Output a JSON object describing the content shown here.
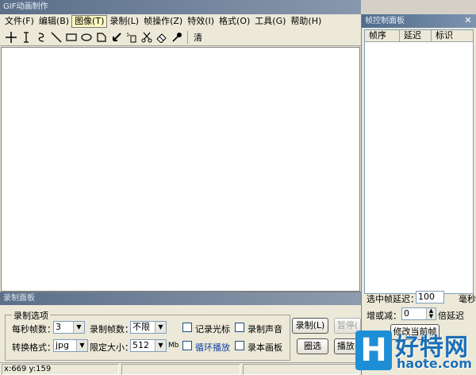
{
  "main_window": {
    "title": "GIF动画制作"
  },
  "menu": [
    {
      "label": "文件(F)"
    },
    {
      "label": "编辑(B)"
    },
    {
      "label": "图像(T)"
    },
    {
      "label": "录制(L)"
    },
    {
      "label": "帧操作(Z)"
    },
    {
      "label": "特效(I)"
    },
    {
      "label": "格式(O)"
    },
    {
      "label": "工具(G)"
    },
    {
      "label": "帮助(H)"
    }
  ],
  "toolbar": {
    "last_label": "清",
    "tools": [
      "crosshair-icon",
      "text-cursor-icon",
      "curve-icon",
      "line-icon",
      "rectangle-icon",
      "ellipse-icon",
      "polygon-icon",
      "arrow-icon",
      "spray-icon",
      "scissors-icon",
      "eraser-icon",
      "eyedropper-icon"
    ]
  },
  "record_panel": {
    "title": "录制面板",
    "group_label": "录制选项",
    "fps_label": "每秒帧数：",
    "fps_value": "3",
    "frames_label": "录制帧数：",
    "frames_value": "不限",
    "record_cursor": "记录光标",
    "record_sound": "录制声音",
    "format_label": "转换格式：",
    "format_value": "jpg",
    "size_label": "限定大小：",
    "size_value": "512",
    "size_unit": "Mb",
    "loop_play": "循环播放",
    "record_canvas": "录本画板",
    "btn_record": "录制(L)",
    "btn_pause": "暂停(",
    "btn_select": "圈选",
    "btn_play": "播放("
  },
  "statusbar": {
    "coords": "x:669 y:159"
  },
  "frame_panel": {
    "title": "帧控制面板",
    "columns": [
      "帧序",
      "延迟",
      "标识"
    ],
    "delay_label": "选中帧延迟：",
    "delay_value": "100",
    "delay_unit": "毫秒",
    "inc_label": "增或减：",
    "inc_value": "0",
    "inc_unit": "倍延迟",
    "btn_modify": "修改当前帧"
  },
  "watermark": {
    "logo_letter": "H",
    "brand_cn": "好特网",
    "brand_en": "haote.com"
  }
}
